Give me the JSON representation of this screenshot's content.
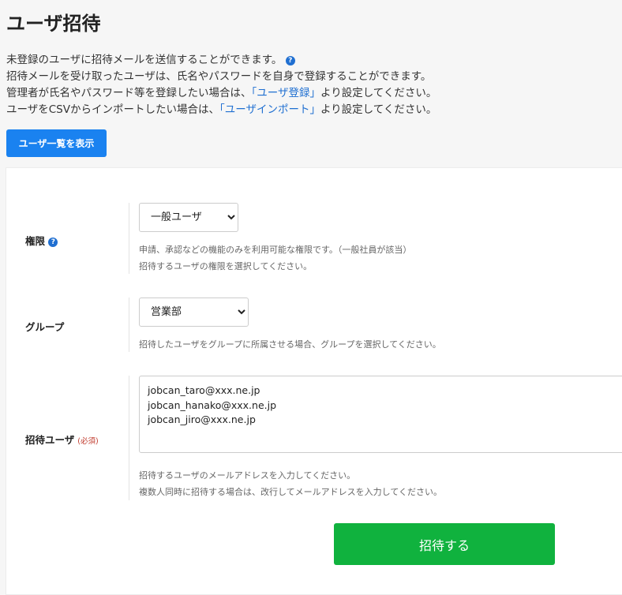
{
  "page_title": "ユーザ招待",
  "description": {
    "line1": "未登録のユーザに招待メールを送信することができます。",
    "line2": "招待メールを受け取ったユーザは、氏名やパスワードを自身で登録することができます。",
    "line3_before": "管理者が氏名やパスワード等を登録したい場合は、",
    "line3_link": "「ユーザ登録」",
    "line3_after": "より設定してください。",
    "line4_before": "ユーザをCSVからインポートしたい場合は、",
    "line4_link": "「ユーザインポート」",
    "line4_after": "より設定してください。"
  },
  "help_icon_glyph": "?",
  "user_list_button": "ユーザ一覧を表示",
  "form": {
    "role": {
      "label": "権限",
      "selected": "一般ユーザ",
      "hint1": "申請、承認などの機能のみを利用可能な権限です。（一般社員が該当）",
      "hint2": "招待するユーザの権限を選択してください。"
    },
    "group": {
      "label": "グループ",
      "selected": "営業部",
      "hint": "招待したユーザをグループに所属させる場合、グループを選択してください。"
    },
    "invite_users": {
      "label": "招待ユーザ",
      "required": "(必須)",
      "value": "jobcan_taro@xxx.ne.jp\njobcan_hanako@xxx.ne.jp\njobcan_jiro@xxx.ne.jp",
      "hint1": "招待するユーザのメールアドレスを入力してください。",
      "hint2": "複数人同時に招待する場合は、改行してメールアドレスを入力してください。"
    }
  },
  "submit_button": "招待する",
  "colors": {
    "primary": "#1a82f0",
    "success": "#10b23e",
    "link": "#1f6fd1",
    "required": "#c0392b"
  }
}
